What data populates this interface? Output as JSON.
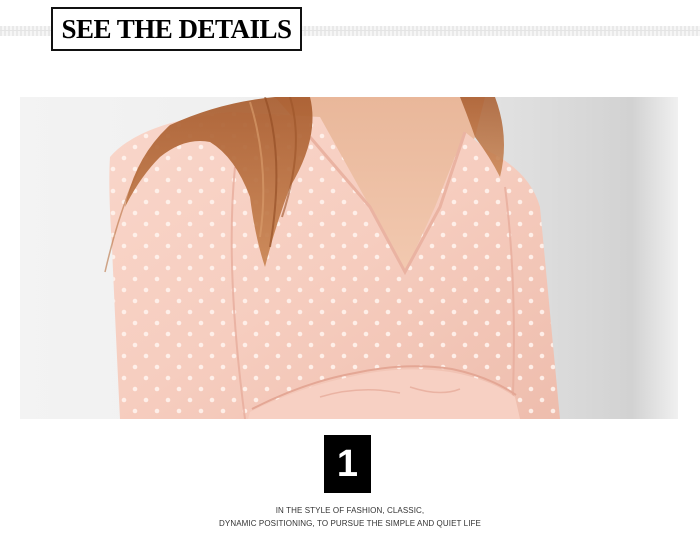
{
  "header": {
    "title": "SEE THE DETAILS"
  },
  "photo": {
    "subject": "blouse-photo",
    "background_color": "#eeeeee",
    "garment_color": "#f7cfc3",
    "dot_color": "#fff1ec",
    "hair_color": "#b66a3a",
    "skin_color": "#efc2a6"
  },
  "badge": {
    "number": "1"
  },
  "caption": {
    "line1": "IN THE STYLE OF FASHION, CLASSIC,",
    "line2": "DYNAMIC POSITIONING, TO PURSUE THE SIMPLE AND QUIET LIFE"
  }
}
